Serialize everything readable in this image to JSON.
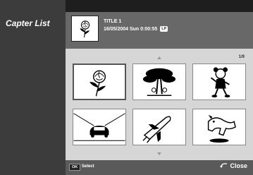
{
  "sidebar": {
    "title": "Capter List"
  },
  "header": {
    "title": "TITLE 1",
    "info": "16/05/2004 Sun 0:00:55",
    "badge": "LP"
  },
  "main": {
    "page_counter": "1/9",
    "chapters": [
      {
        "icon": "rose-icon",
        "selected": true
      },
      {
        "icon": "tree-icon",
        "selected": false
      },
      {
        "icon": "cartoon-figure-icon",
        "selected": false
      },
      {
        "icon": "car-icon",
        "selected": false
      },
      {
        "icon": "space-shuttle-icon",
        "selected": false
      },
      {
        "icon": "dog-icon",
        "selected": false
      }
    ]
  },
  "footer": {
    "ok_badge": "OK",
    "ok_label": "Select",
    "close_label": "Close"
  }
}
